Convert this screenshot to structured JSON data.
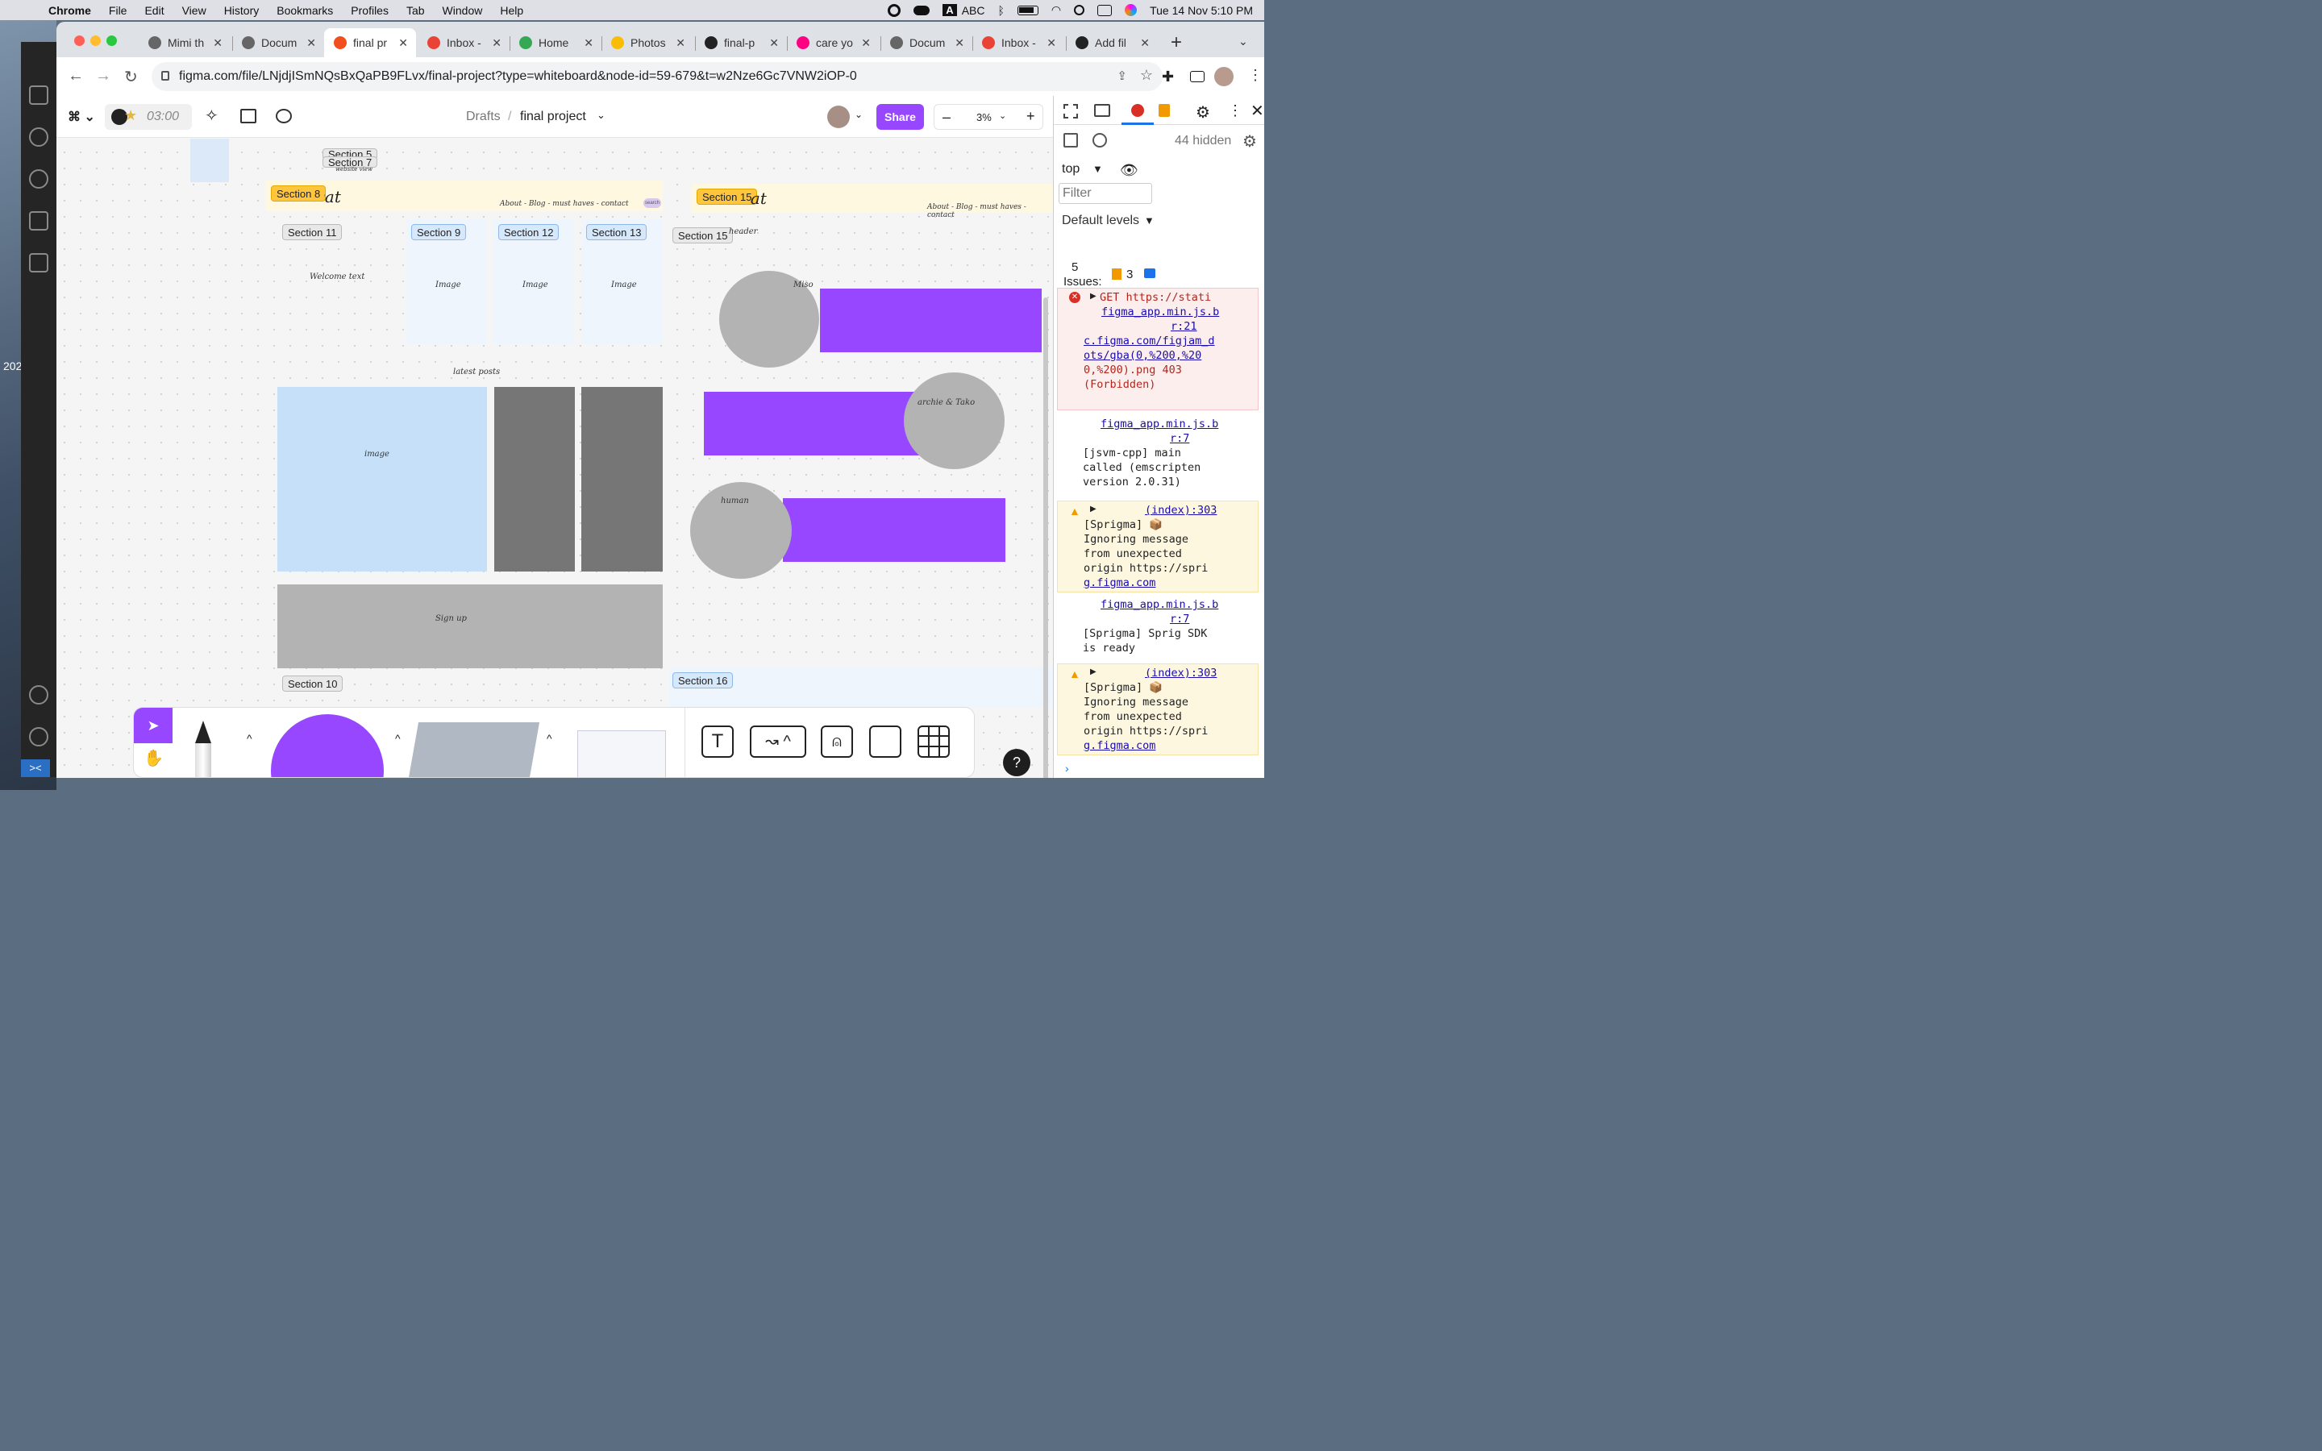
{
  "macos": {
    "app": "Chrome",
    "menus": [
      "File",
      "Edit",
      "View",
      "History",
      "Bookmarks",
      "Profiles",
      "Tab",
      "Window",
      "Help"
    ],
    "input_source": "ABC",
    "input_letter": "A",
    "clock": "Tue 14 Nov  5:10 PM"
  },
  "desktop_label": "202",
  "browser": {
    "tabs": [
      {
        "title": "Mimi th",
        "icon": "globe-icon"
      },
      {
        "title": "Docum",
        "icon": "globe-icon"
      },
      {
        "title": "final pr",
        "icon": "figma-icon",
        "active": true
      },
      {
        "title": "Inbox -",
        "icon": "gmail-icon"
      },
      {
        "title": "Home",
        "icon": "drive-icon"
      },
      {
        "title": "Photos",
        "icon": "photos-icon"
      },
      {
        "title": "final-p",
        "icon": "github-icon"
      },
      {
        "title": "care yo",
        "icon": "flickr-icon"
      },
      {
        "title": "Docum",
        "icon": "globe-icon"
      },
      {
        "title": "Inbox -",
        "icon": "gmail-icon"
      },
      {
        "title": "Add fil",
        "icon": "github-icon"
      }
    ],
    "url": "figma.com/file/LNjdjISmNQsBxQaPB9FLvx/final-project?type=whiteboard&node-id=59-679&t=w2Nze6Gc7VNW2iOP-0"
  },
  "figma": {
    "timer": "03:00",
    "breadcrumb_parent": "Drafts",
    "breadcrumb_sep": "/",
    "file_name": "final project",
    "share_label": "Share",
    "zoom": "3%",
    "zoom_minus": "–",
    "zoom_plus": "+",
    "canvas": {
      "sections": [
        "Section 5",
        "Section 7",
        "Section 8",
        "Section 11",
        "Section 9",
        "Section 12",
        "Section 13",
        "Section 15",
        "Section 8",
        "Section 10",
        "Section 16"
      ],
      "logo_text": "ike is cat",
      "logo_text2": "ike is cat",
      "nav_text": "About - Blog - must haves - contact",
      "nav_text2": "About - Blog - must haves - contact",
      "search_text": "search",
      "welcome": "Welcome text",
      "image_labels": [
        "Image",
        "Image",
        "Image"
      ],
      "latest_posts": "latest posts",
      "big_image": "image",
      "sign_up": "Sign up",
      "header_text": "header",
      "miso": "Miso",
      "archie": "archie & Tako",
      "human": "human",
      "website_view": "website view"
    },
    "help": "?"
  },
  "devtools": {
    "hidden": "44 hidden",
    "context": "top",
    "filter_placeholder": "Filter",
    "levels": "Default levels",
    "issues_count": "5",
    "issues_label": "Issues:",
    "issues_warn": "3",
    "messages": [
      {
        "type": "error",
        "lines": [
          "GET https://stati",
          "figma_app.min.js.b",
          "r:21",
          "c.figma.com/figjam_d",
          "ots/gba(0,%200,%20",
          "0,%200).png 403",
          "(Forbidden)"
        ]
      },
      {
        "type": "info",
        "src": "figma_app.min.js.b",
        "src2": "r:7",
        "lines": [
          "[jsvm-cpp] main",
          "called (emscripten",
          "version 2.0.31)"
        ]
      },
      {
        "type": "warn",
        "src": "(index):303",
        "lines": [
          "[Sprigma] 📦",
          "Ignoring message",
          "from unexpected",
          "origin https://spri",
          "g.figma.com"
        ]
      },
      {
        "type": "info",
        "src": "figma_app.min.js.b",
        "src2": "r:7",
        "lines": [
          "[Sprigma] Sprig SDK",
          "is ready"
        ]
      },
      {
        "type": "warn",
        "src": "(index):303",
        "lines": [
          "[Sprigma] 📦",
          "Ignoring message",
          "from unexpected",
          "origin https://spri",
          "g.figma.com"
        ]
      }
    ]
  }
}
